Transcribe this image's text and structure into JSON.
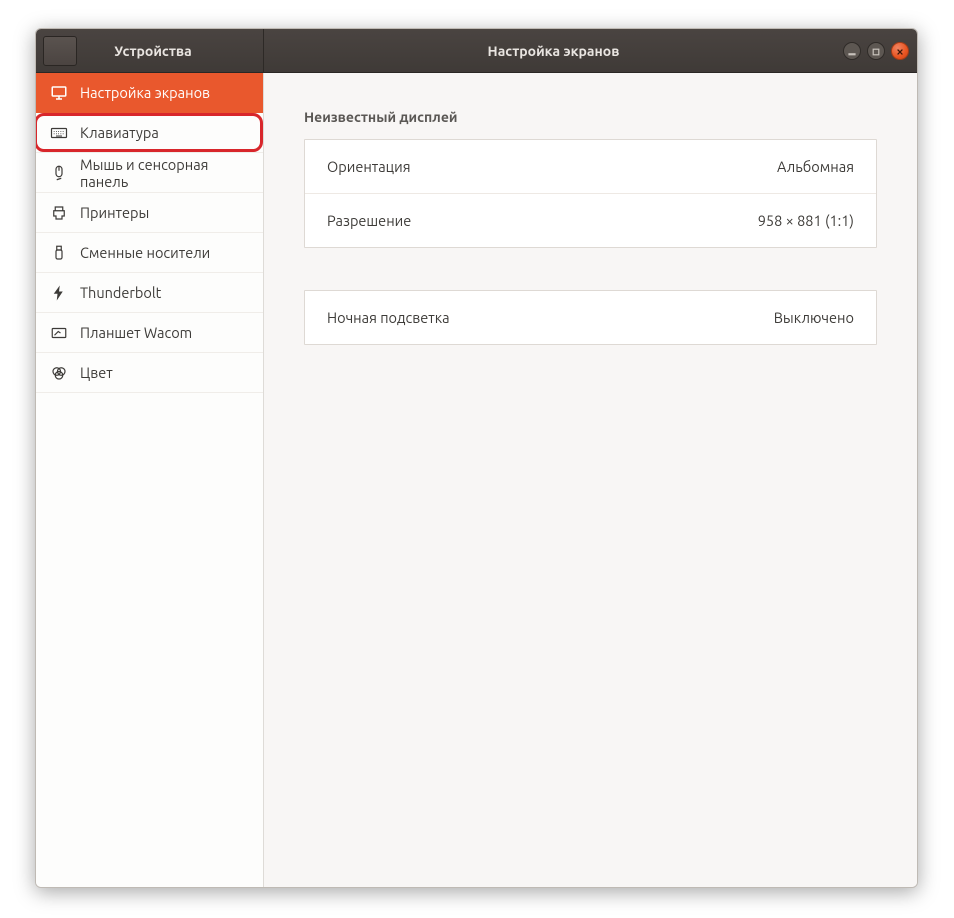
{
  "header": {
    "back_category": "Устройства",
    "page_title": "Настройка экранов"
  },
  "sidebar": {
    "items": [
      {
        "id": "displays",
        "label": "Настройка экранов",
        "active": true
      },
      {
        "id": "keyboard",
        "label": "Клавиатура",
        "active": false,
        "highlight": true
      },
      {
        "id": "mouse",
        "label": "Мышь и сенсорная панель",
        "active": false
      },
      {
        "id": "printers",
        "label": "Принтеры",
        "active": false
      },
      {
        "id": "removable",
        "label": "Сменные носители",
        "active": false
      },
      {
        "id": "thunderbolt",
        "label": "Thunderbolt",
        "active": false
      },
      {
        "id": "wacom",
        "label": "Планшет Wacom",
        "active": false
      },
      {
        "id": "color",
        "label": "Цвет",
        "active": false
      }
    ]
  },
  "main": {
    "section_title": "Неизвестный дисплей",
    "rows_group1": [
      {
        "label": "Ориентация",
        "value": "Альбомная"
      },
      {
        "label": "Разрешение",
        "value": "958 × 881 (1:1)"
      }
    ],
    "rows_group2": [
      {
        "label": "Ночная подсветка",
        "value": "Выключено"
      }
    ]
  }
}
